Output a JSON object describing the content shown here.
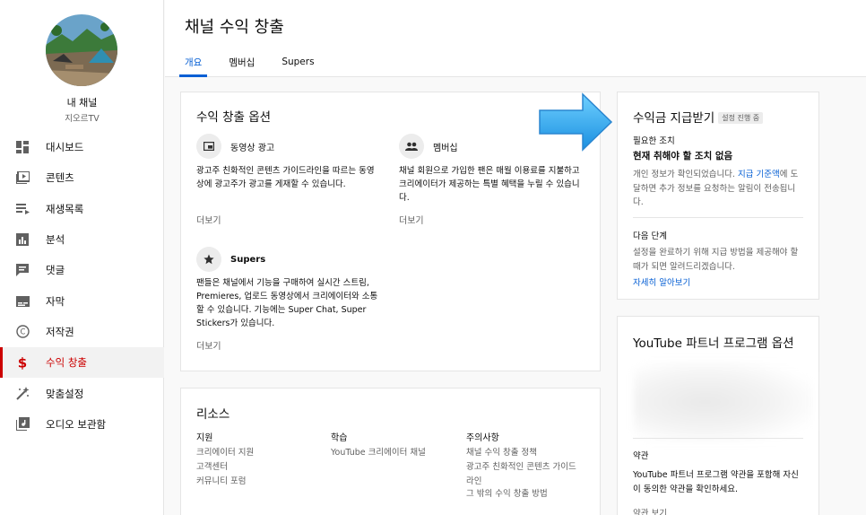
{
  "sidebar": {
    "channel_name": "내 채널",
    "channel_handle": "지오르TV",
    "items": [
      {
        "label": "대시보드",
        "icon": "dashboard-icon"
      },
      {
        "label": "콘텐츠",
        "icon": "content-icon"
      },
      {
        "label": "재생목록",
        "icon": "playlist-icon"
      },
      {
        "label": "분석",
        "icon": "analytics-icon"
      },
      {
        "label": "댓글",
        "icon": "comments-icon"
      },
      {
        "label": "자막",
        "icon": "subtitles-icon"
      },
      {
        "label": "저작권",
        "icon": "copyright-icon"
      },
      {
        "label": "수익 창출",
        "icon": "monetization-icon",
        "active": true
      },
      {
        "label": "맞춤설정",
        "icon": "customization-icon"
      },
      {
        "label": "오디오 보관함",
        "icon": "audio-library-icon"
      }
    ]
  },
  "header": {
    "title": "채널 수익 창출",
    "tabs": [
      {
        "label": "개요",
        "active": true
      },
      {
        "label": "멤버십"
      },
      {
        "label": "Supers"
      }
    ]
  },
  "options": {
    "title": "수익 창출 옵션",
    "ads": {
      "label": "동영상 광고",
      "desc_l1": "광고주 친화적인 콘텐츠 가이드라인을 따르는 동영",
      "desc_l2": "상에 광고주가 광고를 게재할 수 있습니다.",
      "more": "더보기"
    },
    "membership": {
      "label": "멤버십",
      "desc_l1": "채널 회원으로 가입한 팬은 매월 이용료를 지불하고",
      "desc_l2": "크리에이터가 제공하는 특별 혜택을 누릴 수 있습니",
      "desc_l3": "다.",
      "more": "더보기"
    },
    "supers": {
      "label": "Supers",
      "desc_l1": "팬들은 채널에서 기능을 구매하여 실시간 스트림,",
      "desc_l2": "Premieres, 업로드 동영상에서 크리에이터와 소통",
      "desc_l3": "할 수 있습니다. 기능에는 Super Chat, Super",
      "desc_l4": "Stickers가 있습니다.",
      "more": "더보기"
    }
  },
  "resources": {
    "title": "리소스",
    "support": {
      "title": "지원",
      "links": [
        "크리에이터 지원",
        "고객센터",
        "커뮤니티 포럼"
      ]
    },
    "learn": {
      "title": "학습",
      "links": [
        "YouTube 크리에이터 채널"
      ]
    },
    "notes": {
      "title": "주의사항",
      "links": [
        "채널 수익 창출 정책",
        "광고주 친화적인 콘텐츠 가이드",
        "라인",
        "그 밖의 수익 창출 방법"
      ]
    }
  },
  "payout": {
    "title": "수익금 지급받기",
    "badge": "설정 진행 중",
    "required_label": "필요한 조치",
    "required_value": "현재 취해야 할 조치 없음",
    "info_l1_a": "개인 정보가 확인되었습니다. ",
    "info_l1_link": "지급 기준액",
    "info_l1_b": "에 도",
    "info_l2": "달하면 추가 정보를 요청하는 알림이 전송됩니",
    "info_l3": "다.",
    "next_label": "다음 단계",
    "next_l1": "설정을 완료하기 위해 지급 방법을 제공해야 할",
    "next_l2": "때가 되면 알려드리겠습니다.",
    "learn_more": "자세히 알아보기"
  },
  "ypp": {
    "title": "YouTube 파트너 프로그램 옵션",
    "terms_label": "약관",
    "terms_l1": "YouTube 파트너 프로그램 약관을 포함해 자신",
    "terms_l2": "이 동의한 약관을 확인하세요.",
    "terms_link": "약관 보기"
  },
  "colors": {
    "accent_blue": "#065fd4",
    "active_red": "#cc0000",
    "arrow_blue": "#2ea0ea"
  }
}
